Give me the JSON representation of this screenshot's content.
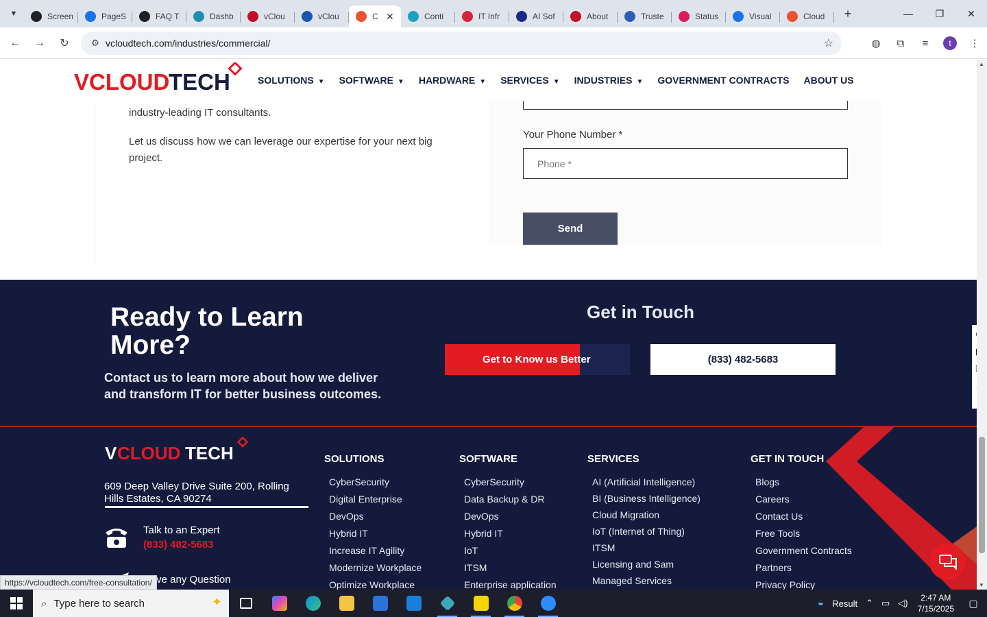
{
  "browser": {
    "tabs": [
      {
        "label": "Screen",
        "color": "#202124"
      },
      {
        "label": "PageS",
        "color": "#1a73e8"
      },
      {
        "label": "FAQ T",
        "color": "#202124"
      },
      {
        "label": "Dashb",
        "color": "#1d8fb3"
      },
      {
        "label": "vClou",
        "color": "#c0102b"
      },
      {
        "label": "vClou",
        "color": "#1a56b0"
      },
      {
        "label": "C",
        "color": "#e8542e",
        "active": true
      },
      {
        "label": "Conti",
        "color": "#1ca0c8"
      },
      {
        "label": "IT Infr",
        "color": "#d4243b"
      },
      {
        "label": "AI Sof",
        "color": "#1a2a8a"
      },
      {
        "label": "About",
        "color": "#c0102b"
      },
      {
        "label": "Truste",
        "color": "#2b5fb3"
      },
      {
        "label": "Status",
        "color": "#d91c5c"
      },
      {
        "label": "Visual",
        "color": "#1a73e8"
      },
      {
        "label": "Cloud",
        "color": "#e8542e"
      }
    ],
    "url": "vcloudtech.com/industries/commercial/",
    "profile_initial": "t",
    "status_url": "https://vcloudtech.com/free-consultation/"
  },
  "site": {
    "logo_left": "V",
    "logo_mid": "CLOUD",
    "logo_right": "TECH",
    "nav": [
      {
        "label": "SOLUTIONS",
        "caret": true
      },
      {
        "label": "SOFTWARE",
        "caret": true
      },
      {
        "label": "HARDWARE",
        "caret": true
      },
      {
        "label": "SERVICES",
        "caret": true
      },
      {
        "label": "INDUSTRIES",
        "caret": true
      },
      {
        "label": "GOVERNMENT CONTRACTS",
        "caret": false
      },
      {
        "label": "ABOUT US",
        "caret": false
      }
    ]
  },
  "content": {
    "para1": "industry-leading IT consultants.",
    "para2": "Let us discuss how we can leverage our expertise for your next big project.",
    "phone_label": "Your Phone Number *",
    "phone_placeholder": "Phone *",
    "send_label": "Send"
  },
  "cta": {
    "heading": "Ready to Learn More?",
    "subtext": "Contact us to learn more about how we deliver and transform IT for better business outcomes.",
    "get_in_touch": "Get in Touch",
    "know_button": "Get to Know us Better",
    "phone_button": "(833) 482-5683"
  },
  "footer": {
    "address": "609 Deep Valley Drive Suite 200, Rolling Hills Estates, CA 90274",
    "talk_label": "Talk to an Expert",
    "talk_phone": "(833) 482-5683",
    "question_label": "Have any Question",
    "columns": [
      {
        "heading": "SOLUTIONS",
        "links": [
          "CyberSecurity",
          "Digital Enterprise",
          "DevOps",
          "Hybrid IT",
          "Increase IT Agility",
          "Modernize Workplace",
          "Optimize Workplace"
        ]
      },
      {
        "heading": "SOFTWARE",
        "links": [
          "CyberSecurity",
          "Data Backup & DR",
          "DevOps",
          "Hybrid IT",
          "IoT",
          "ITSM",
          "Enterprise application"
        ]
      },
      {
        "heading": "SERVICES",
        "links": [
          "AI (Artificial Intelligence)",
          "BI (Business Intelligence)",
          "Cloud Migration",
          "IoT (Internet of Thing)",
          "ITSM",
          "Licensing and Sam",
          "Managed Services"
        ]
      },
      {
        "heading": "GET IN TOUCH",
        "links": [
          "Blogs",
          "Careers",
          "Contact Us",
          "Free Tools",
          "Government Contracts",
          "Partners",
          "Privacy Policy"
        ]
      }
    ]
  },
  "taskbar": {
    "search_placeholder": "Type here to search",
    "weather": "Result",
    "time": "2:47 AM",
    "date": "7/15/2025"
  },
  "colors": {
    "brand_red": "#e31b23",
    "navy": "#141a3c",
    "send_gray": "#474e66"
  }
}
